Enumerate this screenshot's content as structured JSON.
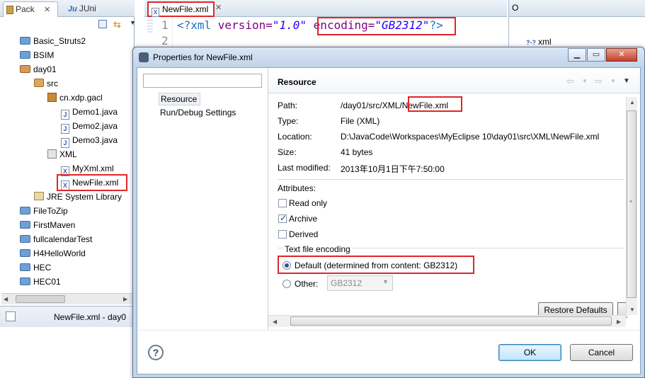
{
  "left_panel": {
    "tabs": [
      {
        "label": "Pack",
        "close": "✕"
      },
      {
        "label": "JUni",
        "icon_text": "Ju"
      }
    ],
    "tree": [
      {
        "label": "Basic_Struts2",
        "icon": "folder-icon"
      },
      {
        "label": "BSIM",
        "icon": "folder-icon"
      },
      {
        "label": "day01",
        "icon": "folder-icon"
      },
      {
        "label": "src",
        "icon": "src-icon"
      },
      {
        "label": "cn.xdp.gacl",
        "icon": "package-icon"
      },
      {
        "label": "Demo1.java",
        "icon": "java-icon"
      },
      {
        "label": "Demo2.java",
        "icon": "java-icon"
      },
      {
        "label": "Demo3.java",
        "icon": "java-icon"
      },
      {
        "label": "XML",
        "icon": "package-icon"
      },
      {
        "label": "MyXml.xml",
        "icon": "xml-icon"
      },
      {
        "label": "NewFile.xml",
        "icon": "xml-icon"
      },
      {
        "label": "JRE System Library",
        "icon": "library-icon"
      },
      {
        "label": "FileToZip",
        "icon": "folder-icon"
      },
      {
        "label": "FirstMaven",
        "icon": "folder-icon"
      },
      {
        "label": "fullcalendarTest",
        "icon": "folder-icon"
      },
      {
        "label": "H4HelloWorld",
        "icon": "folder-icon"
      },
      {
        "label": "HEC",
        "icon": "folder-icon"
      },
      {
        "label": "HEC01",
        "icon": "folder-icon"
      }
    ],
    "status": "NewFile.xml - day0"
  },
  "editor": {
    "tab_label": "NewFile.xml",
    "tab_close": "✕",
    "line_numbers": [
      "1",
      "2"
    ],
    "code": {
      "open": "<?xml ",
      "version_attr": "version=",
      "version_val": "\"1.0\"",
      "space": " ",
      "encoding_attr": "encoding=",
      "encoding_val": "\"GB2312\"",
      "close": "?>"
    }
  },
  "outline": {
    "tab_label": "O",
    "item": "xml"
  },
  "dialog": {
    "title": "Properties for NewFile.xml",
    "nav": {
      "filter_placeholder": "",
      "items": [
        "Resource",
        "Run/Debug Settings"
      ]
    },
    "page_title": "Resource",
    "properties": {
      "path_label": "Path:",
      "path_prefix": "/day01/src/XML/",
      "path_file": "NewFile.xml",
      "type_label": "Type:",
      "type_value": "File  (XML)",
      "location_label": "Location:",
      "location_value": "D:\\JavaCode\\Workspaces\\MyEclipse 10\\day01\\src\\XML\\NewFile.xml",
      "size_label": "Size:",
      "size_value": "41  bytes",
      "modified_label": "Last modified:",
      "modified_value": "2013年10月1日下午7:50:00"
    },
    "attributes": {
      "label": "Attributes:",
      "read_only": {
        "label": "Read only",
        "checked": false
      },
      "archive": {
        "label": "Archive",
        "checked": true
      },
      "derived": {
        "label": "Derived",
        "checked": false
      }
    },
    "encoding": {
      "group_label": "Text file encoding",
      "default_label": "Default (determined from content: GB2312)",
      "other_label": "Other:",
      "other_value": "GB2312",
      "selected": "default"
    },
    "restore_defaults": "Restore Defaults",
    "ok": "OK",
    "cancel": "Cancel",
    "help": "?"
  },
  "colors": {
    "highlight": "#e0262a",
    "accent": "#3c7fb1"
  }
}
